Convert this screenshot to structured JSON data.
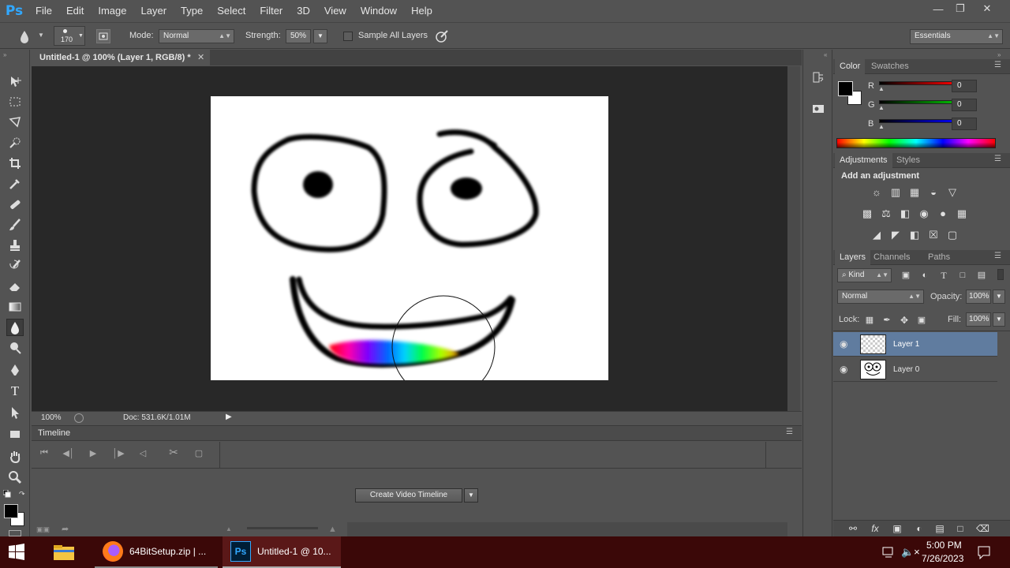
{
  "app": {
    "logo": "Ps",
    "name": "Adobe Photoshop"
  },
  "menu": [
    "File",
    "Edit",
    "Image",
    "Layer",
    "Type",
    "Select",
    "Filter",
    "3D",
    "View",
    "Window",
    "Help"
  ],
  "window_controls": {
    "minimize": "minimize-icon",
    "restore": "restore-icon",
    "close": "close-icon"
  },
  "options": {
    "brush_size": "170",
    "mode_label": "Mode:",
    "mode_value": "Normal",
    "strength_label": "Strength:",
    "strength_value": "50%",
    "sample_all_layers": "Sample All Layers",
    "sample_all_checked": false,
    "workspace": "Essentials"
  },
  "document": {
    "tab_title": "Untitled-1 @ 100% (Layer 1, RGB/8) *",
    "zoom": "100%",
    "doc_info": "Doc: 531.6K/1.01M"
  },
  "timeline": {
    "title": "Timeline",
    "create_button": "Create Video Timeline"
  },
  "color_panel": {
    "tabs": [
      "Color",
      "Swatches"
    ],
    "channels": [
      {
        "label": "R",
        "value": "0",
        "color": "#ff0000"
      },
      {
        "label": "G",
        "value": "0",
        "color": "#00c000"
      },
      {
        "label": "B",
        "value": "0",
        "color": "#0000ff"
      }
    ],
    "foreground": "#000000",
    "background": "#ffffff"
  },
  "adjustments_panel": {
    "tabs": [
      "Adjustments",
      "Styles"
    ],
    "heading": "Add an adjustment"
  },
  "layers_panel": {
    "tabs": [
      "Layers",
      "Channels",
      "Paths"
    ],
    "kind_label": "Kind",
    "blend_mode": "Normal",
    "opacity_label": "Opacity:",
    "opacity_value": "100%",
    "lock_label": "Lock:",
    "fill_label": "Fill:",
    "fill_value": "100%",
    "layers": [
      {
        "name": "Layer 1",
        "selected": true,
        "visible": true
      },
      {
        "name": "Layer 0",
        "selected": false,
        "visible": true
      }
    ]
  },
  "taskbar": {
    "items": [
      {
        "label": "64BitSetup.zip | ...",
        "icon": "firefox-icon"
      },
      {
        "label": "Untitled-1 @ 10...",
        "icon": "photoshop-icon"
      }
    ],
    "time": "5:00 PM",
    "date": "7/26/2023"
  }
}
